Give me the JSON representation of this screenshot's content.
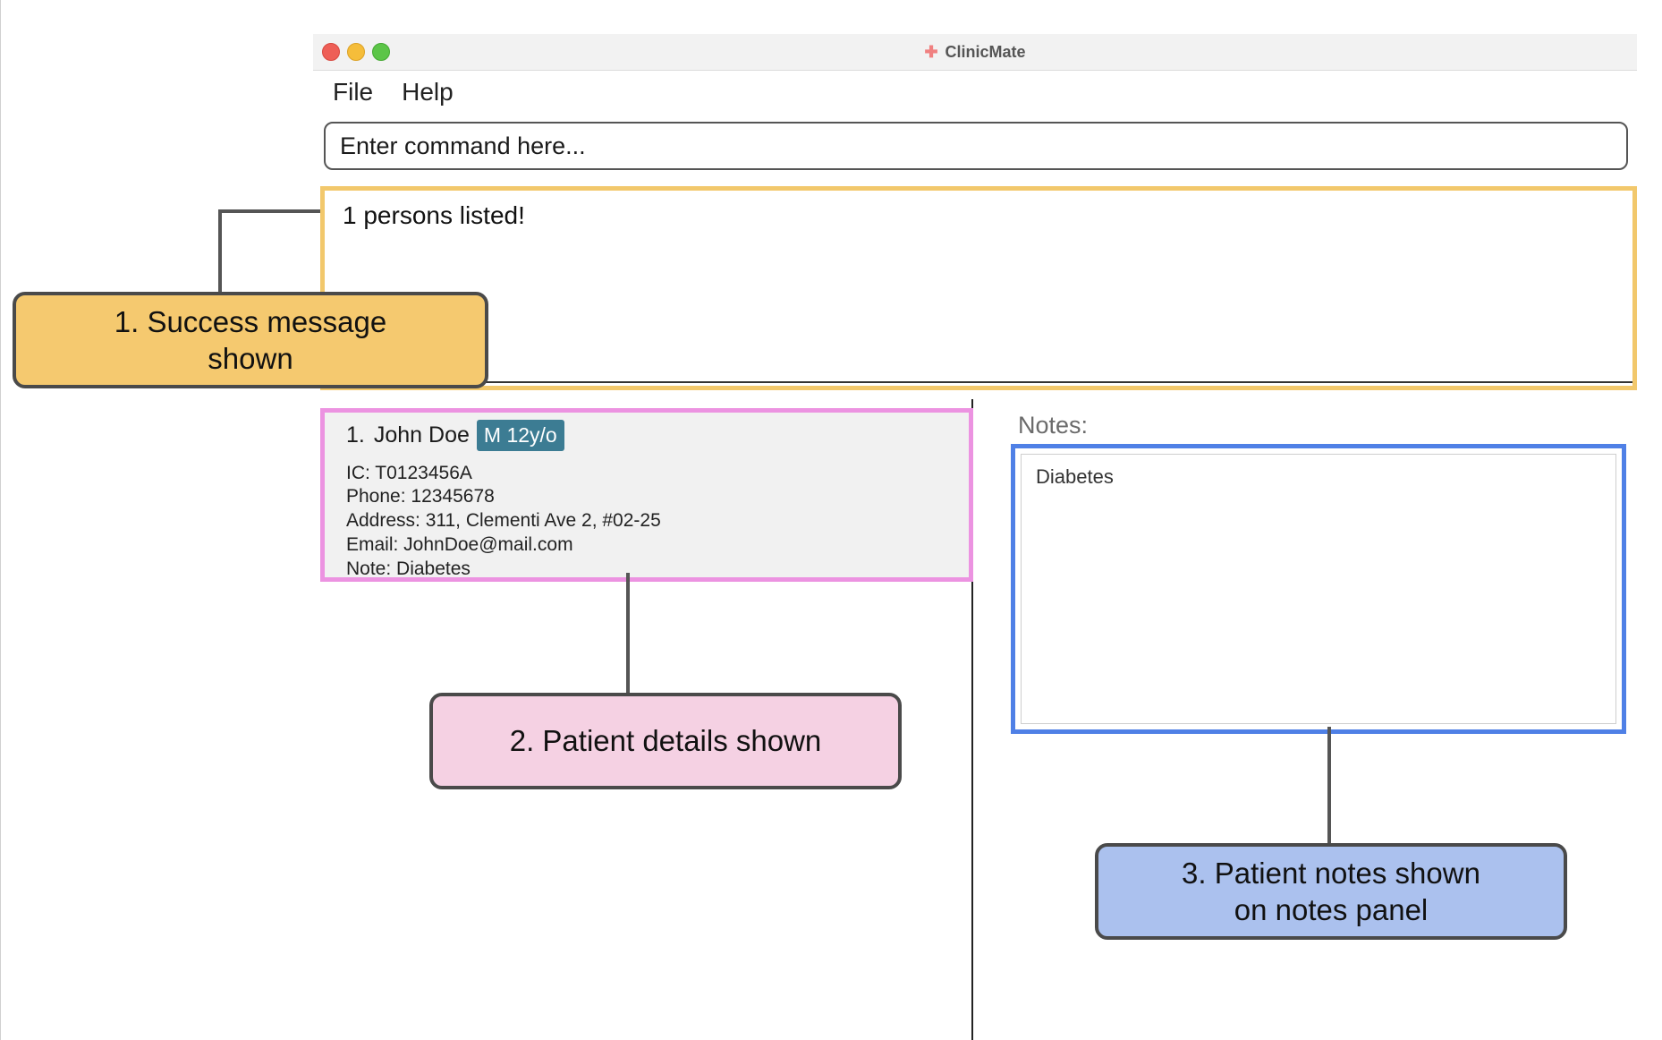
{
  "window": {
    "title": "ClinicMate",
    "icon": "plus-icon"
  },
  "menu": {
    "items": [
      "File",
      "Help"
    ]
  },
  "command": {
    "placeholder": "Enter command here..."
  },
  "result": {
    "message": "1 persons listed!"
  },
  "person_list": [
    {
      "index": "1.",
      "name": "John Doe",
      "tag": "M 12y/o",
      "ic": "IC: T0123456A",
      "phone": "Phone: 12345678",
      "address": "Address: 311, Clementi Ave 2, #02-25",
      "email": "Email: JohnDoe@mail.com",
      "note": "Note: Diabetes"
    }
  ],
  "notes_panel": {
    "label": "Notes:",
    "content": "Diabetes"
  },
  "annotations": {
    "success": "1. Success message\nshown",
    "details": "2. Patient details shown",
    "notes": "3. Patient notes shown\non notes panel"
  },
  "colors": {
    "result_border": "#f2c86c",
    "card_border": "#ec93e1",
    "notes_border": "#4f80e6",
    "tag_bg": "#3c7c93",
    "callout_success": "#f5c96f",
    "callout_details": "#f5d1e3",
    "callout_notes": "#abc1ee"
  }
}
